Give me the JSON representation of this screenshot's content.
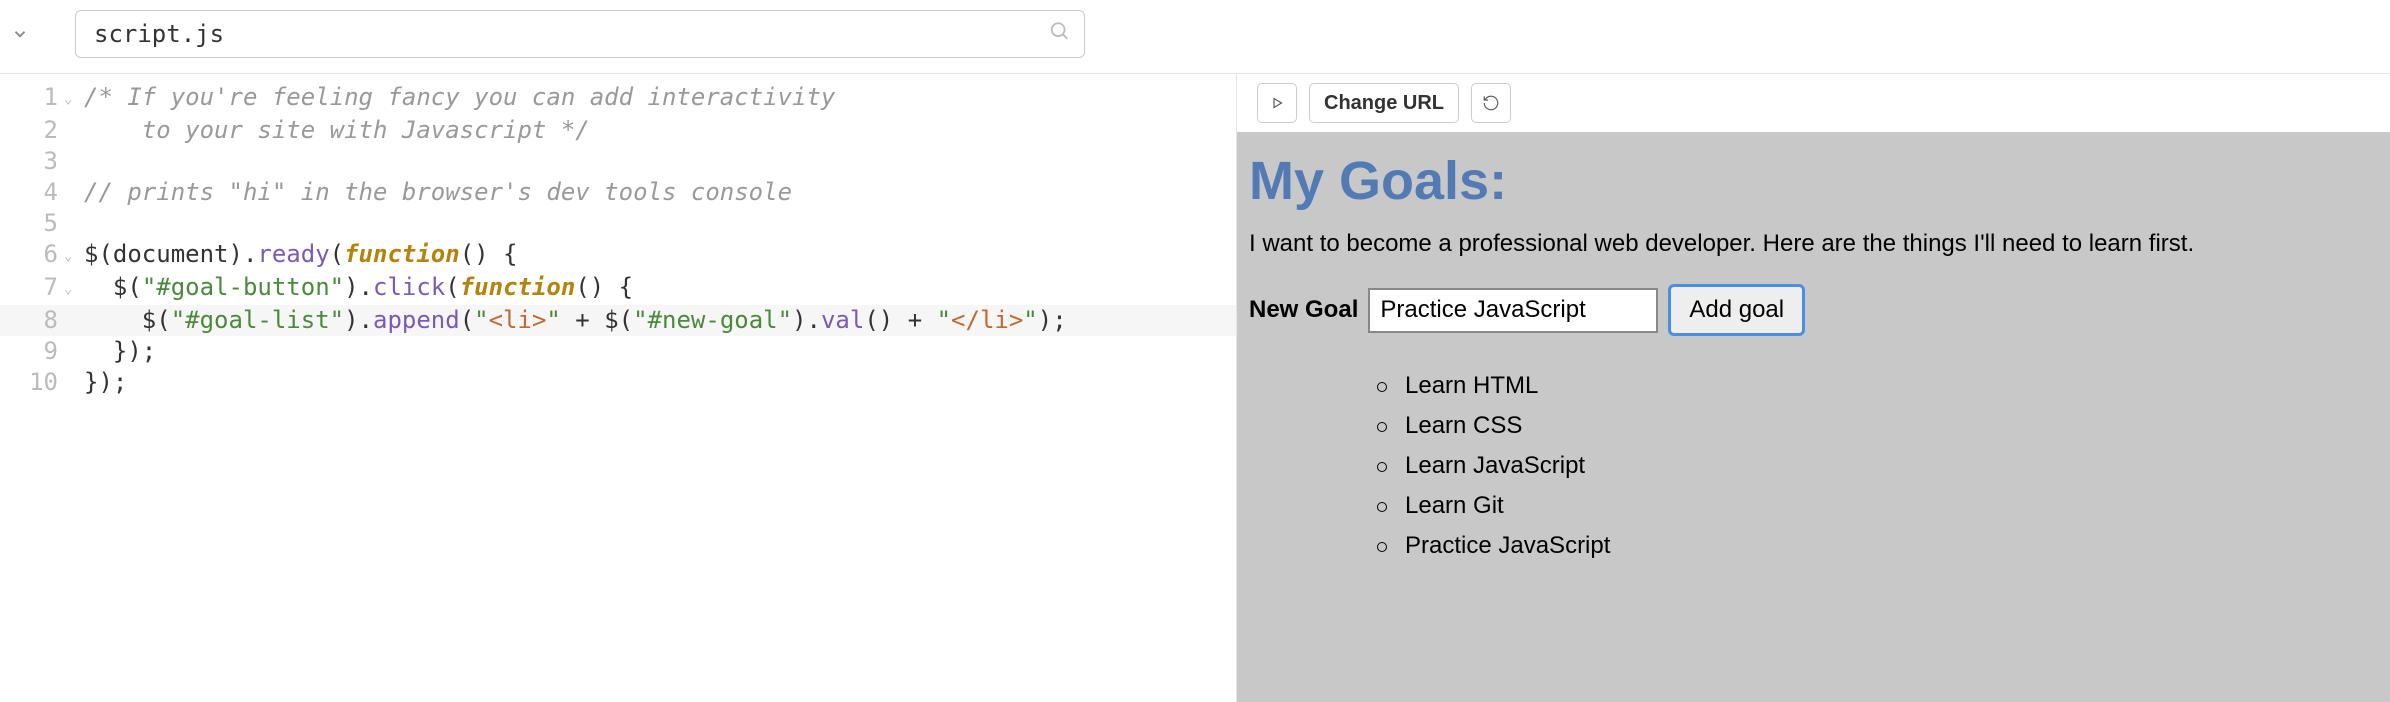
{
  "header": {
    "filename": "script.js"
  },
  "editor": {
    "lines": [
      {
        "num": "1",
        "fold": true,
        "tokens": [
          [
            "comment",
            "/* If you're feeling fancy you can add interactivity"
          ]
        ]
      },
      {
        "num": "2",
        "fold": false,
        "tokens": [
          [
            "comment",
            "    to your site with Javascript */"
          ]
        ]
      },
      {
        "num": "3",
        "fold": false,
        "tokens": []
      },
      {
        "num": "4",
        "fold": false,
        "tokens": [
          [
            "comment",
            "// prints \"hi\" in the browser's dev tools console"
          ]
        ]
      },
      {
        "num": "5",
        "fold": false,
        "tokens": []
      },
      {
        "num": "6",
        "fold": true,
        "tokens": [
          [
            "var",
            "$"
          ],
          [
            "punc",
            "("
          ],
          [
            "var",
            "document"
          ],
          [
            "punc",
            ")."
          ],
          [
            "prop",
            "ready"
          ],
          [
            "punc",
            "("
          ],
          [
            "keyword",
            "function"
          ],
          [
            "punc",
            "() {"
          ]
        ]
      },
      {
        "num": "7",
        "fold": true,
        "tokens": [
          [
            "punc",
            "  "
          ],
          [
            "var",
            "$"
          ],
          [
            "punc",
            "("
          ],
          [
            "string",
            "\"#goal-button\""
          ],
          [
            "punc",
            ")."
          ],
          [
            "prop",
            "click"
          ],
          [
            "punc",
            "("
          ],
          [
            "keyword",
            "function"
          ],
          [
            "punc",
            "() {"
          ]
        ]
      },
      {
        "num": "8",
        "fold": false,
        "current": true,
        "tokens": [
          [
            "punc",
            "    "
          ],
          [
            "var",
            "$"
          ],
          [
            "punc",
            "("
          ],
          [
            "string",
            "\"#goal-list\""
          ],
          [
            "punc",
            ")."
          ],
          [
            "prop",
            "append"
          ],
          [
            "punc",
            "("
          ],
          [
            "string",
            "\""
          ],
          [
            "attr",
            "<li>"
          ],
          [
            "string",
            "\""
          ],
          [
            "punc",
            " + "
          ],
          [
            "var",
            "$"
          ],
          [
            "punc",
            "("
          ],
          [
            "string",
            "\"#new-goal\""
          ],
          [
            "punc",
            ")."
          ],
          [
            "prop",
            "val"
          ],
          [
            "punc",
            "() + "
          ],
          [
            "string",
            "\""
          ],
          [
            "attr",
            "</li>"
          ],
          [
            "string",
            "\""
          ],
          [
            "punc",
            ");"
          ]
        ]
      },
      {
        "num": "9",
        "fold": false,
        "tokens": [
          [
            "punc",
            "  });"
          ]
        ]
      },
      {
        "num": "10",
        "fold": false,
        "tokens": [
          [
            "punc",
            "});"
          ]
        ]
      }
    ]
  },
  "preview_toolbar": {
    "change_url": "Change URL"
  },
  "preview": {
    "heading": "My Goals:",
    "description": "I want to become a professional web developer. Here are the things I'll need to learn first.",
    "form_label": "New Goal",
    "input_value": "Practice JavaScript",
    "add_button": "Add goal",
    "goals": [
      "Learn HTML",
      "Learn CSS",
      "Learn JavaScript",
      "Learn Git",
      "Practice JavaScript"
    ]
  }
}
